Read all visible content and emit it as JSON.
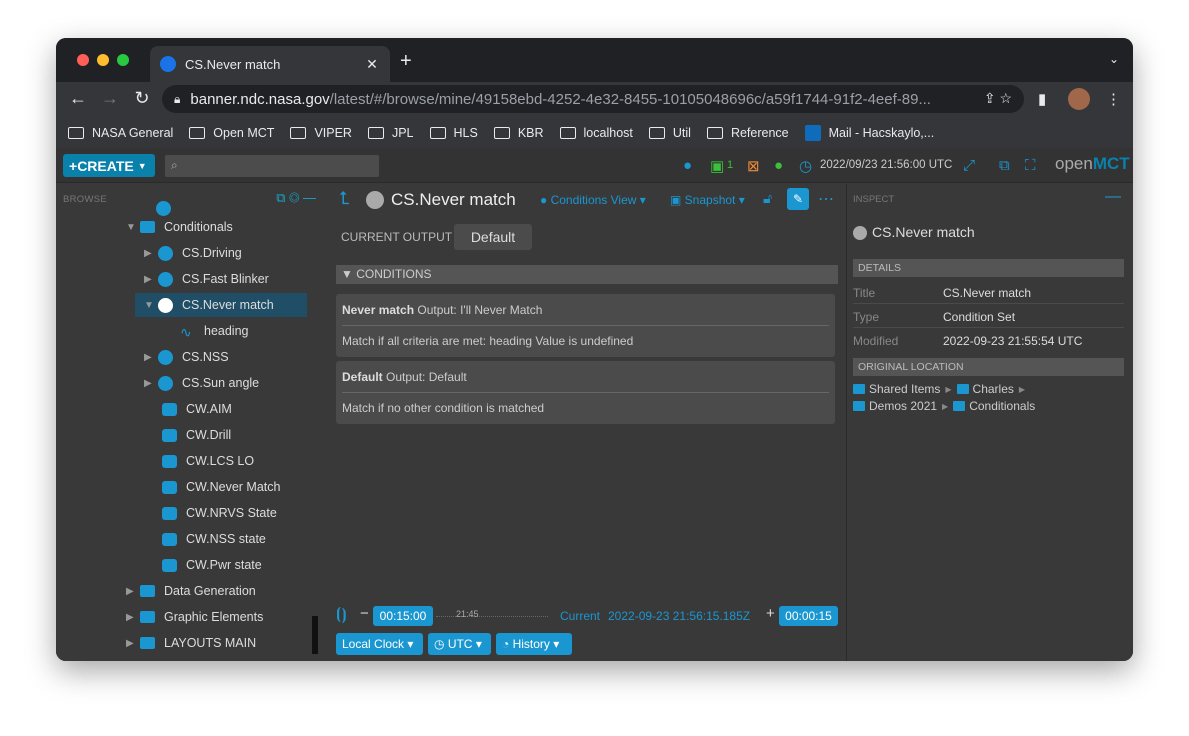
{
  "browser": {
    "tab_title": "CS.Never match",
    "url_host": "banner.ndc.nasa.gov",
    "url_path": "/latest/#/browse/mine/49158ebd-4252-4e32-8455-10105048696c/a59f1744-91f2-4eef-89...",
    "bookmarks": [
      "NASA General",
      "Open MCT",
      "VIPER",
      "JPL",
      "HLS",
      "KBR",
      "localhost",
      "Util",
      "Reference",
      "Mail - Hacskaylo,..."
    ]
  },
  "header": {
    "create_label": "CREATE",
    "snapshot_count": "1",
    "clock": "2022/09/23 21:56:00 UTC",
    "logo_open": "open",
    "logo_mct": "MCT"
  },
  "browse": {
    "label": "BROWSE",
    "items": [
      {
        "label": "Conditionals"
      },
      {
        "label": "CS.Driving"
      },
      {
        "label": "CS.Fast Blinker"
      },
      {
        "label": "CS.Never match"
      },
      {
        "label": "heading"
      },
      {
        "label": "CS.NSS"
      },
      {
        "label": "CS.Sun angle"
      },
      {
        "label": "CW.AIM"
      },
      {
        "label": "CW.Drill"
      },
      {
        "label": "CW.LCS LO"
      },
      {
        "label": "CW.Never Match"
      },
      {
        "label": "CW.NRVS State"
      },
      {
        "label": "CW.NSS state"
      },
      {
        "label": "CW.Pwr state"
      },
      {
        "label": "Data Generation"
      },
      {
        "label": "Graphic Elements"
      },
      {
        "label": "LAYOUTS MAIN"
      }
    ]
  },
  "main": {
    "title": "CS.Never match",
    "view_label": "Conditions View",
    "snapshot_label": "Snapshot",
    "current_output_label": "CURRENT OUTPUT",
    "current_output_value": "Default",
    "conditions_label": "CONDITIONS",
    "conditions": [
      {
        "name": "Never match",
        "output": "Output: I'll Never Match",
        "criteria": "Match if all criteria are met: heading Value is undefined"
      },
      {
        "name": "Default",
        "output": "Output: Default",
        "criteria": "Match if no other condition is matched"
      }
    ]
  },
  "time": {
    "start_offset": "00:15:00",
    "tick": "21:45",
    "current_label": "Current",
    "current_time": "2022-09-23 21:56:15.185Z",
    "end_offset": "00:00:15",
    "clock_label": "Local Clock",
    "timesystem_label": "UTC",
    "history_label": "History"
  },
  "inspect": {
    "label": "INSPECT",
    "title": "CS.Never match",
    "details_label": "DETAILS",
    "props": [
      {
        "key": "Title",
        "value": "CS.Never match"
      },
      {
        "key": "Type",
        "value": "Condition Set"
      },
      {
        "key": "Modified",
        "value": "2022-09-23 21:55:54 UTC"
      }
    ],
    "location_label": "ORIGINAL LOCATION",
    "location": [
      "Shared Items",
      "Charles",
      "Demos 2021",
      "Conditionals"
    ]
  }
}
